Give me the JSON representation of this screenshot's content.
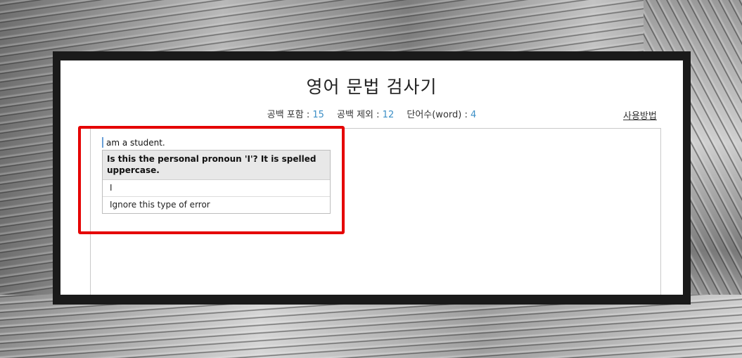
{
  "title": "영어 문법 검사기",
  "stats": {
    "with_spaces_label": "공백 포함 : ",
    "with_spaces_value": "15",
    "without_spaces_label": "공백 제외 : ",
    "without_spaces_value": "12",
    "words_label": "단어수(word) : ",
    "words_value": "4"
  },
  "help_link": "사용방법",
  "editor": {
    "text": "am a student."
  },
  "suggestion_popup": {
    "message": "Is this the personal pronoun 'I'? It is spelled uppercase.",
    "options": [
      "I",
      "Ignore this type of error"
    ]
  },
  "colors": {
    "accent_number": "#3c8fc6",
    "highlight": "#e50000"
  }
}
